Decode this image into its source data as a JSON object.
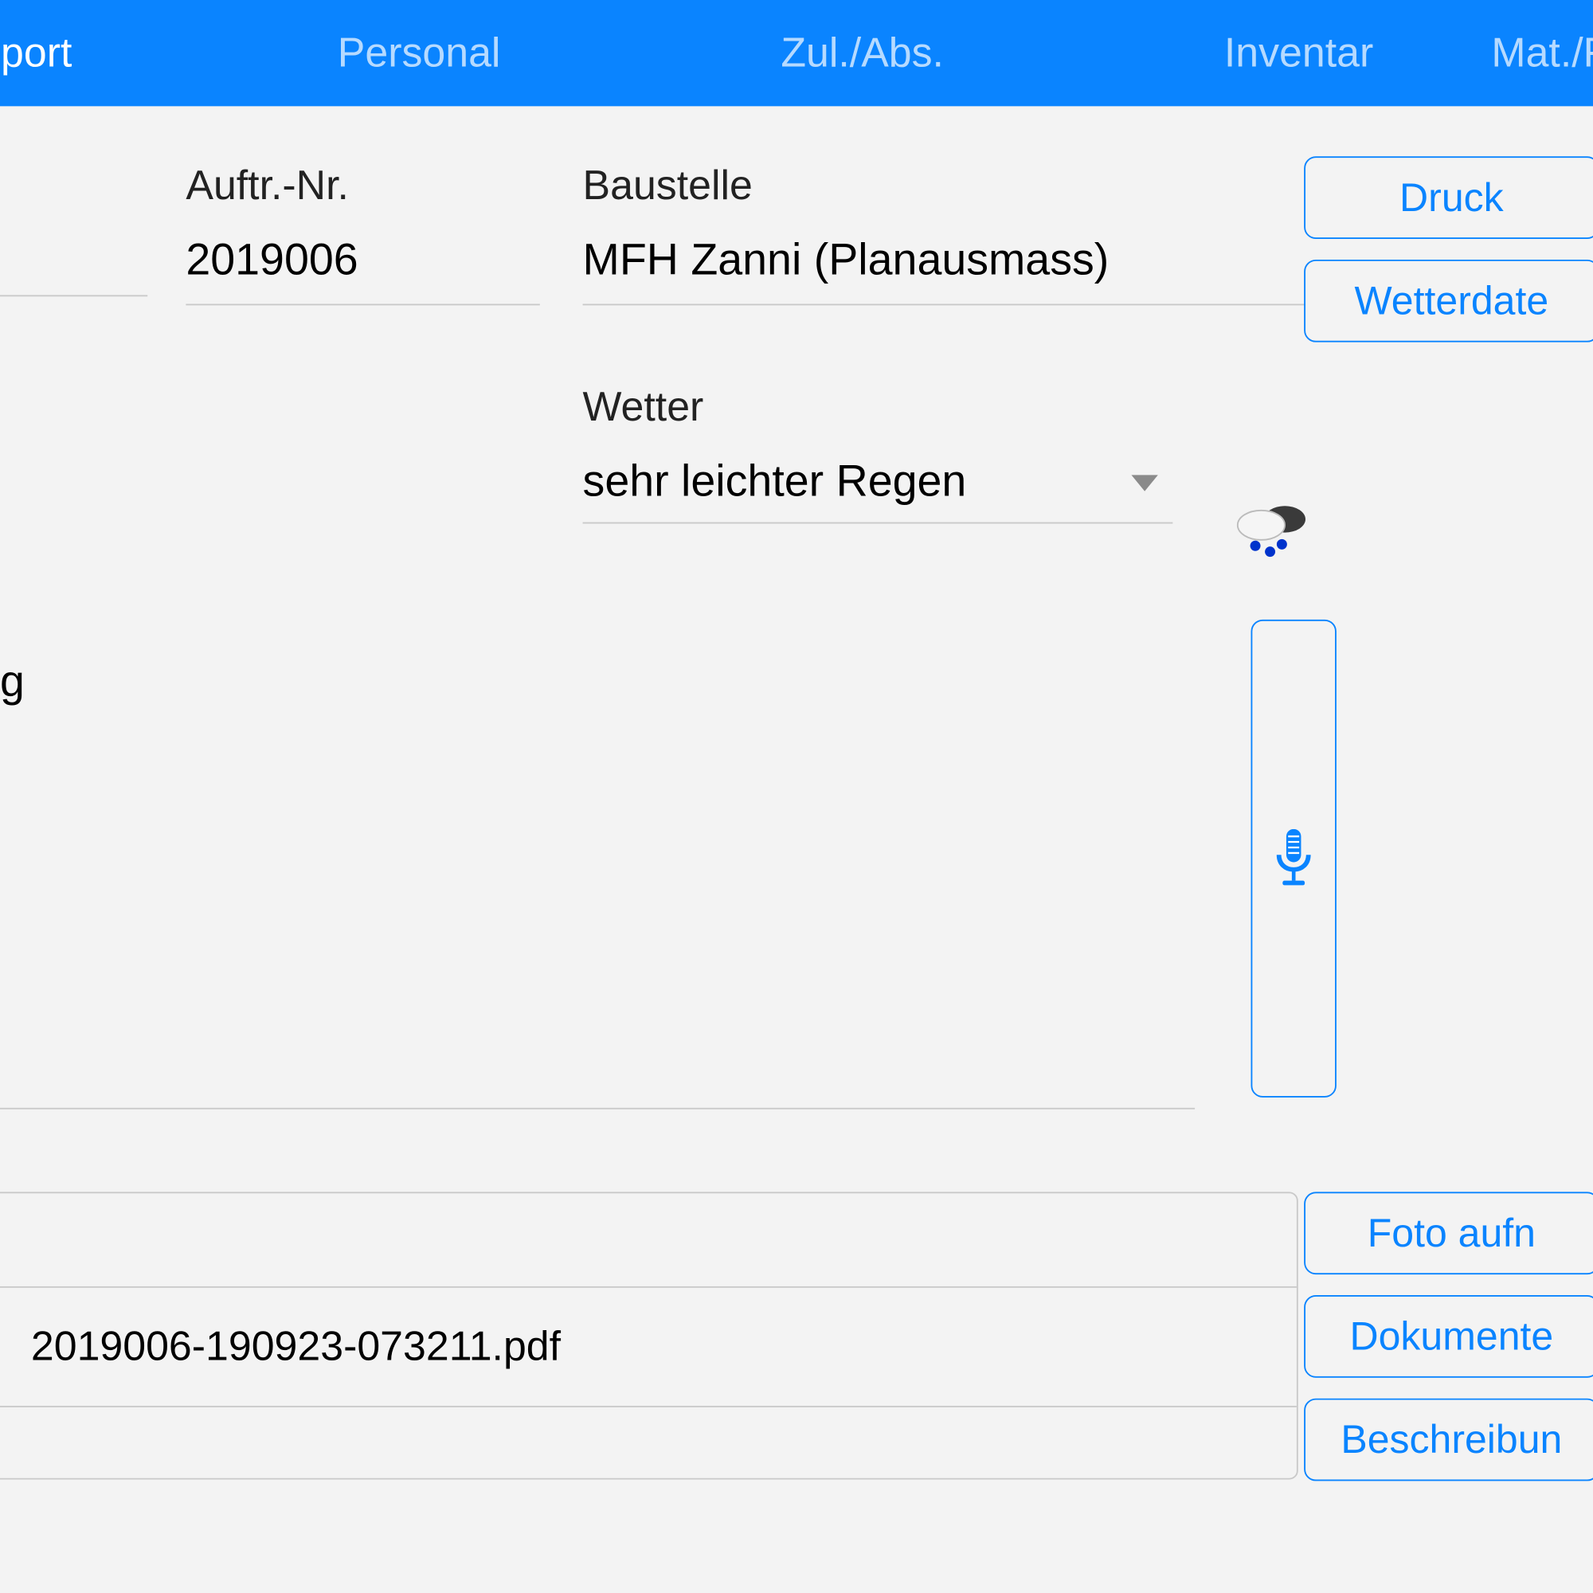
{
  "tabs": {
    "report": "pport",
    "personal": "Personal",
    "zulabs": "Zul./Abs.",
    "inventar": "Inventar",
    "matf": "Mat./F"
  },
  "fields": {
    "order_label": "Auftr.-Nr.",
    "order_value": "2019006",
    "site_label": "Baustelle",
    "site_value": "MFH Zanni (Planausmass)",
    "weather_label": "Wetter",
    "weather_value": "sehr leichter Regen",
    "note_fragment": "g"
  },
  "buttons": {
    "print": "Druck",
    "weather": "Wetterdate",
    "photo": "Foto aufn",
    "doc": "Dokumente",
    "desc": "Beschreibun"
  },
  "files": {
    "pdf1": "2019006-190923-073211.pdf"
  }
}
